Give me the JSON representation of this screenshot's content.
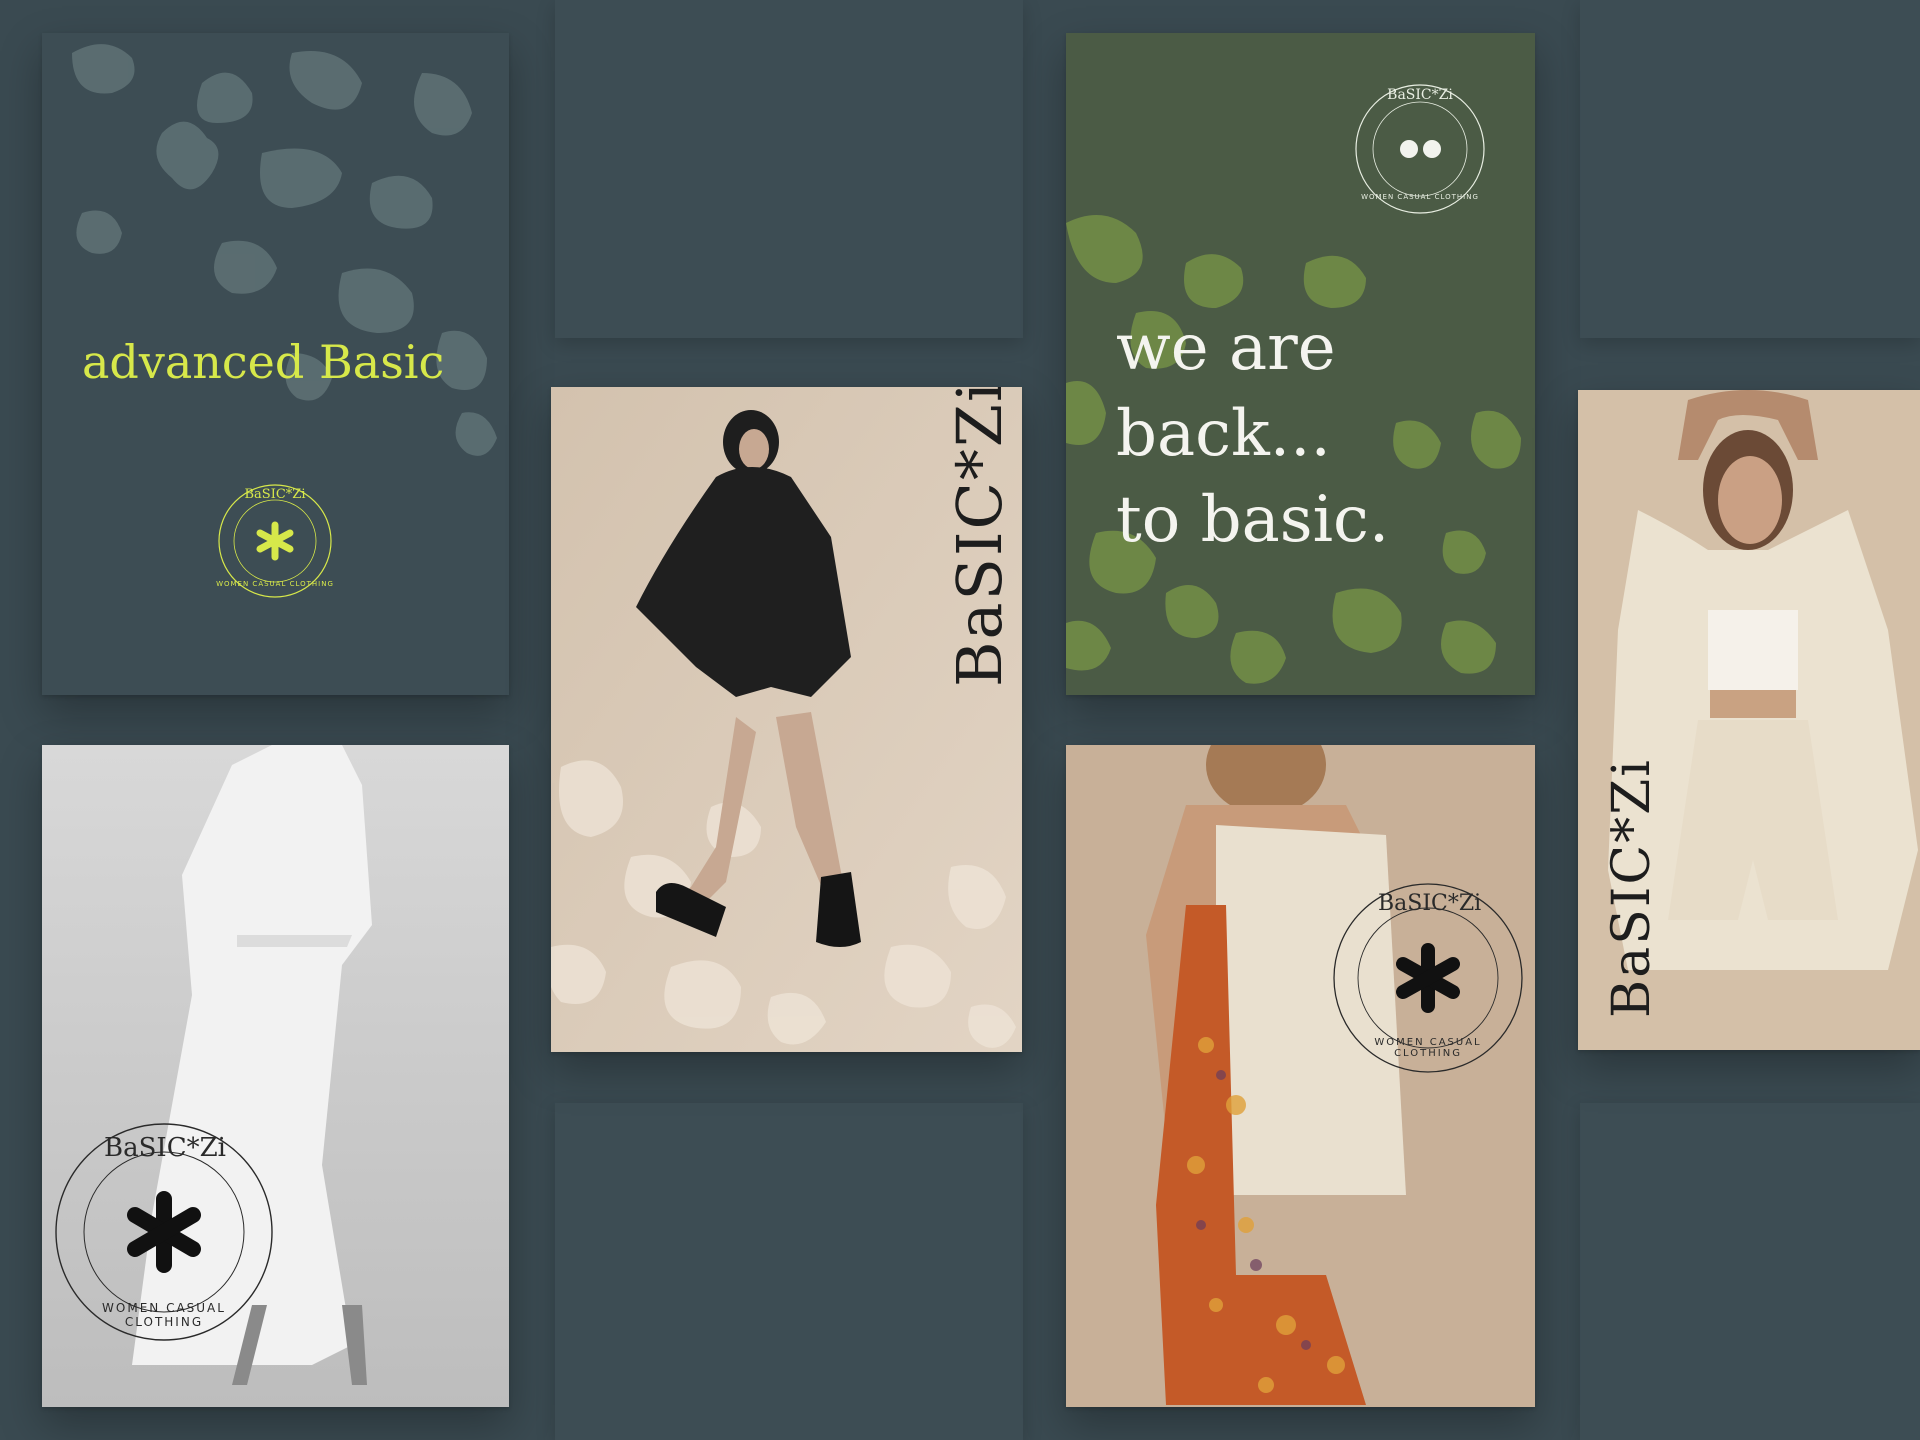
{
  "brand": {
    "logo_text": "BaSIC*Zi",
    "seal_text_top": "BaSIC*Zi",
    "seal_text_ring": "WOMEN CASUAL CLOTHING"
  },
  "cards": {
    "advanced": {
      "headline": "advanced Basic"
    },
    "back": {
      "headline_lines": [
        "we are",
        "back...",
        "to basic."
      ]
    }
  },
  "colors": {
    "background": "#3a4a51",
    "dark_card": "#3d4d54",
    "green_card": "#4a5a44",
    "camo_green": "#6d8746",
    "accent_yellow": "#d7e84a",
    "beige": "#d8c8b4",
    "ink": "#1d1d1d"
  }
}
